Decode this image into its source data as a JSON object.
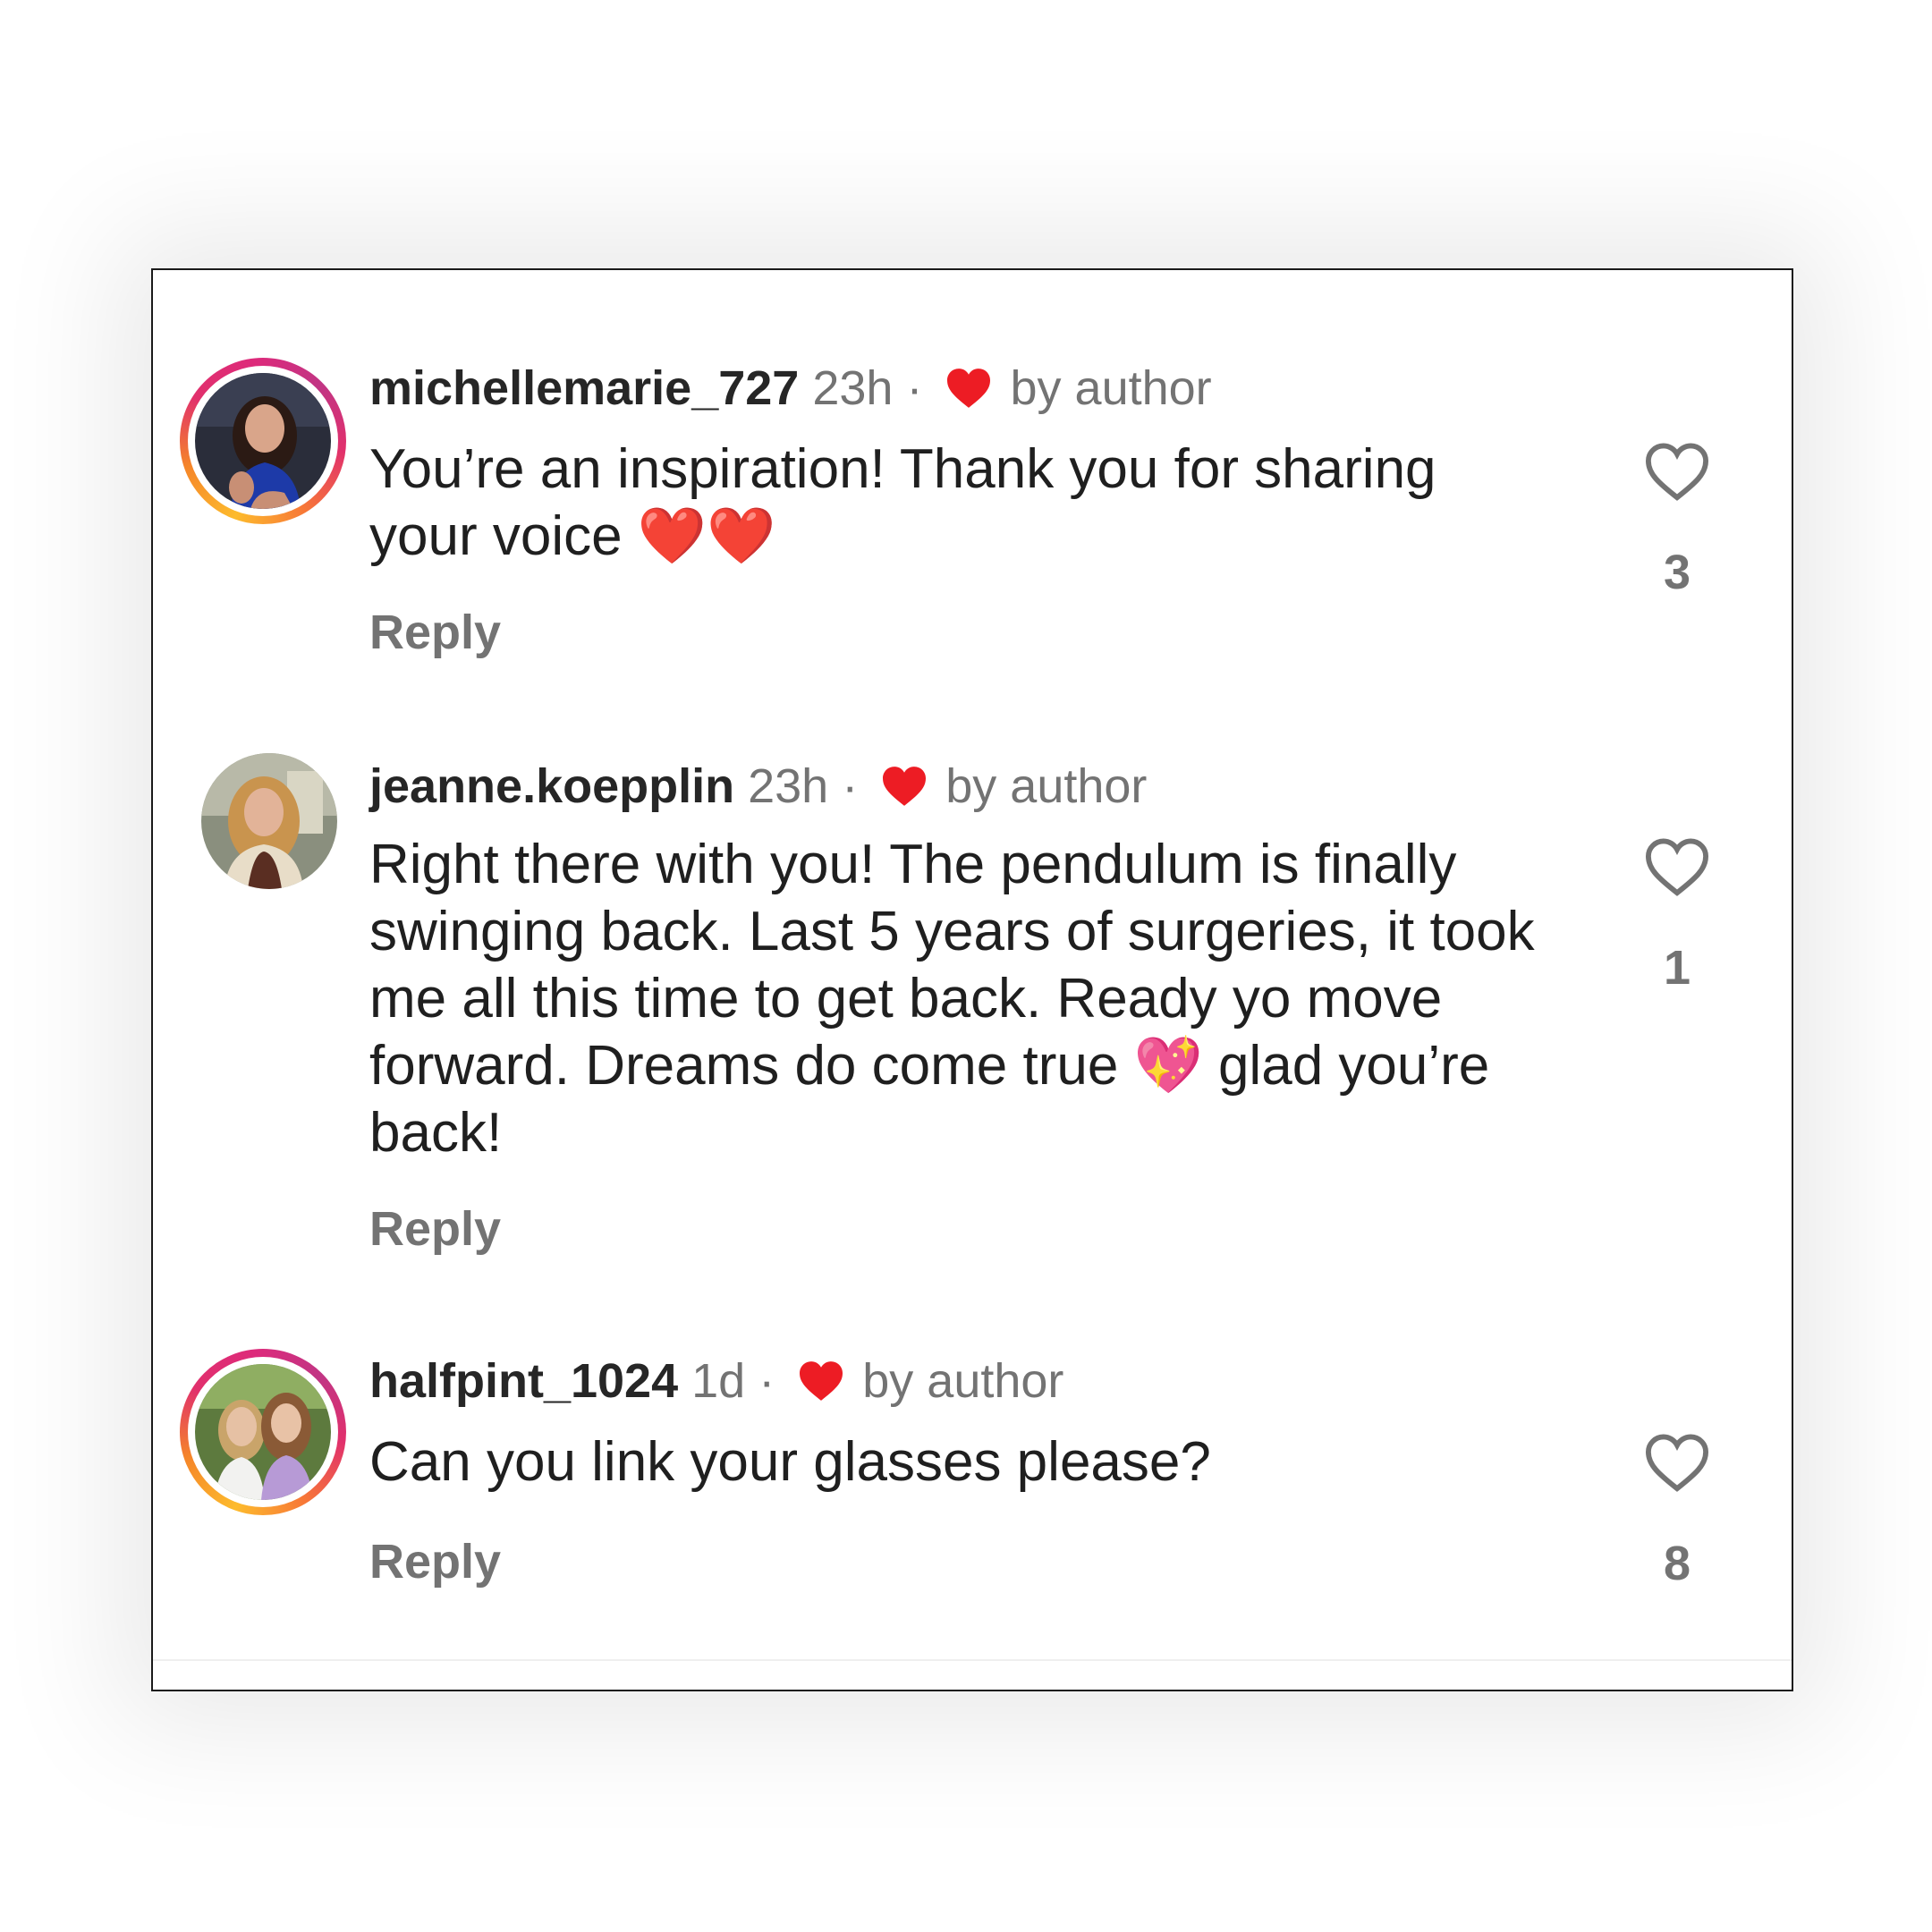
{
  "comments": [
    {
      "username": "michellemarie_727",
      "time": "23h",
      "separator": "·",
      "liked_by": "by author",
      "text": "You’re an inspiration! Thank you for sharing your voice ❤️❤️",
      "reply_label": "Reply",
      "like_count": "3",
      "avatar_icon": "avatar-story-ring",
      "heart_icon": "heart-outline-icon"
    },
    {
      "username": "jeanne.koepplin",
      "time": "23h",
      "separator": "·",
      "liked_by": "by author",
      "text": "Right there with you! The pendulum is finally swinging back. Last 5 years of surgeries, it took me all this time to get back.  Ready yo move forward. Dreams do come true 💖 glad you’re back!",
      "reply_label": "Reply",
      "like_count": "1",
      "avatar_icon": "avatar-plain",
      "heart_icon": "heart-outline-icon"
    },
    {
      "username": "halfpint_1024",
      "time": "1d",
      "separator": "·",
      "liked_by": "by author",
      "text": "Can you link your glasses please?",
      "reply_label": "Reply",
      "like_count": "8",
      "avatar_icon": "avatar-story-ring",
      "heart_icon": "heart-outline-icon"
    }
  ],
  "colors": {
    "author_heart": "#ed1c24",
    "username": "#262626",
    "secondary_text": "#737373",
    "body_text": "#1f1f1f"
  }
}
